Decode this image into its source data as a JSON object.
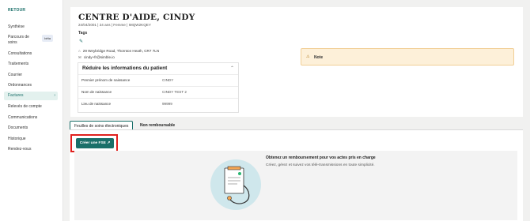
{
  "sidebar": {
    "back": "RETOUR",
    "items": [
      {
        "label": "Synthèse"
      },
      {
        "label": "Parcours de soins",
        "badge": "bêta"
      },
      {
        "label": "Consultations"
      },
      {
        "label": "Traitements"
      },
      {
        "label": "Courrier"
      },
      {
        "label": "Ordonnances"
      },
      {
        "label": "Factures",
        "active": true
      },
      {
        "label": "Relevés de compte"
      },
      {
        "label": "Communications"
      },
      {
        "label": "Documents"
      },
      {
        "label": "Historique"
      },
      {
        "label": "Rendez-vous"
      }
    ]
  },
  "patient": {
    "name": "CENTRE D'AIDE, CINDY",
    "meta": "24/04/2001 | 24 ans | Femme | IMQW2KQEY",
    "tags_label": "Tags",
    "address": "29 Weybridge Road, Thornton Heath, CR7 7LN",
    "email": "cindy+fr@simble.io"
  },
  "info_panel": {
    "title": "Réduire les informations du patient",
    "rows": [
      {
        "label": "Premier prénom de naissance",
        "value": "CINDY"
      },
      {
        "label": "Nom de naissance",
        "value": "CINDY TEST 2"
      },
      {
        "label": "Lieu de naissance",
        "value": "99999"
      }
    ]
  },
  "note": {
    "label": "Note"
  },
  "tabs": [
    {
      "label": "Feuilles de soins électroniques"
    },
    {
      "label": "Non remboursable"
    }
  ],
  "create_button": "Créer une FSE",
  "empty_state": {
    "heading": "Obtenez un remboursement pour vos actes pris en charge",
    "text": "Créez, gérez et suivez vos télé-transmissions en toute simplicité."
  },
  "colors": {
    "accent": "#1a6f69",
    "highlight": "#e0201d",
    "note_bg": "#fdf0d9"
  },
  "icons": [
    "pencil-icon",
    "home-icon",
    "mail-icon",
    "chevron-up-icon",
    "warning-icon",
    "external-link-icon",
    "document-illustration"
  ]
}
